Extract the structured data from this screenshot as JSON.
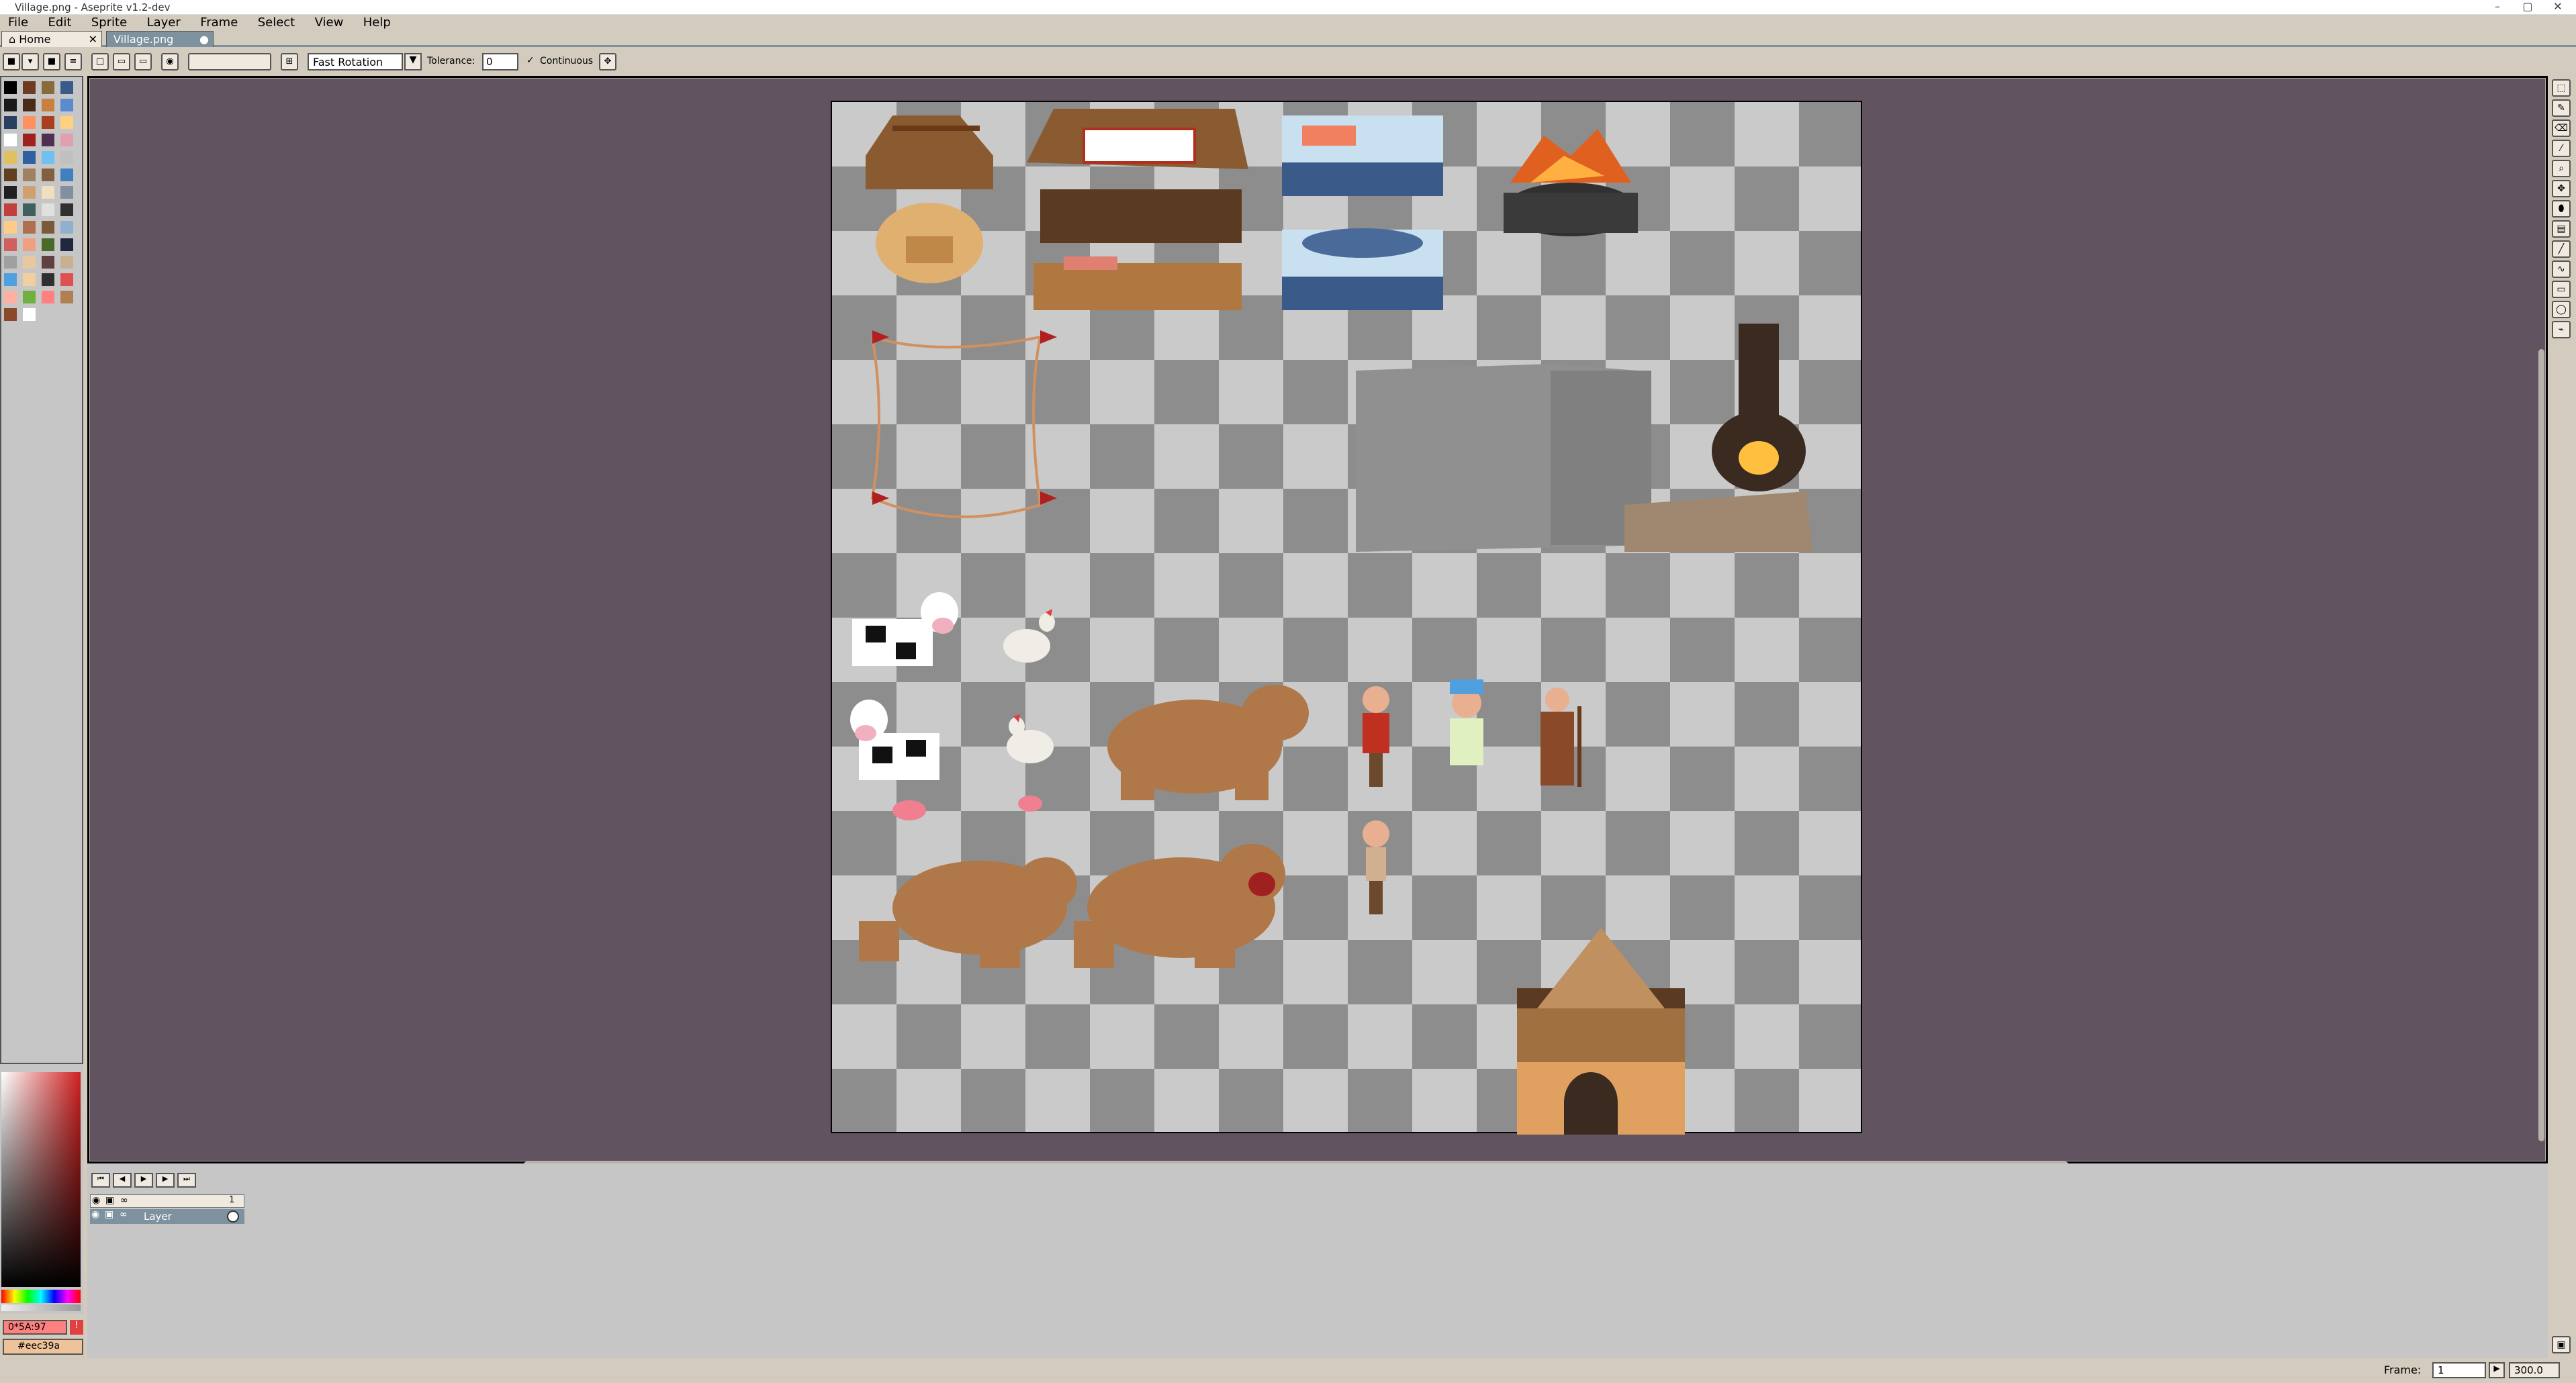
{
  "window": {
    "title": "Village.png - Aseprite v1.2-dev",
    "minimize": "–",
    "maximize": "▢",
    "close": "✕"
  },
  "menu": [
    "File",
    "Edit",
    "Sprite",
    "Layer",
    "Frame",
    "Select",
    "View",
    "Help"
  ],
  "tabs": [
    {
      "label": "Home",
      "close": "✕"
    },
    {
      "label": "Village.png",
      "close": "●"
    }
  ],
  "toolbar": {
    "rotation": "Fast Rotation",
    "tolerance_label": "Tolerance:",
    "tolerance_value": "0",
    "continuous_label": "Continuous",
    "continuous_check": "✓"
  },
  "palette_colors": [
    "#000000",
    "#6e3b1f",
    "#8a6a3a",
    "#3a5a8a",
    "#1a1a1a",
    "#4a2a1a",
    "#c88040",
    "#5a8ad0",
    "#2a4060",
    "#ff9060",
    "#a84020",
    "#ffd080",
    "#ffffff",
    "#a02020",
    "#503050",
    "#e0a0b0",
    "#e0c060",
    "#3060a0",
    "#70c0f0",
    "#c0c0c0",
    "#604020",
    "#a08060",
    "#806040",
    "#4080c0",
    "#202020",
    "#d0a070",
    "#f0e0c0",
    "#8090a0",
    "#c04040",
    "#406060",
    "#e0e0e0",
    "#303030",
    "#ffcc88",
    "#b07050",
    "#7a5a3a",
    "#90b0d0",
    "#d06060",
    "#f0a080",
    "#4a6a2a",
    "#202840",
    "#a0a0a0",
    "#e8c8a0",
    "#604040",
    "#c8b090",
    "#50a0e0",
    "#f0d0a0",
    "#303030",
    "#e05050",
    "#ffb0a0",
    "#70b040",
    "#ff8080",
    "#b08050",
    "#8a4a2a",
    "#ffffff"
  ],
  "sidebar": {
    "fg_color_label": "0*5A:97",
    "bg_color_label": "#eec39a",
    "warning": "!"
  },
  "timeline": {
    "layer_name": "Layer",
    "frame_number": "1"
  },
  "status": {
    "frame_label": "Frame:",
    "frame_value": "1",
    "zoom": "300.0"
  },
  "colors": {
    "app_bg": "#d3cbbe",
    "workspace": "#625360",
    "tab_strip": "#7d929e"
  }
}
